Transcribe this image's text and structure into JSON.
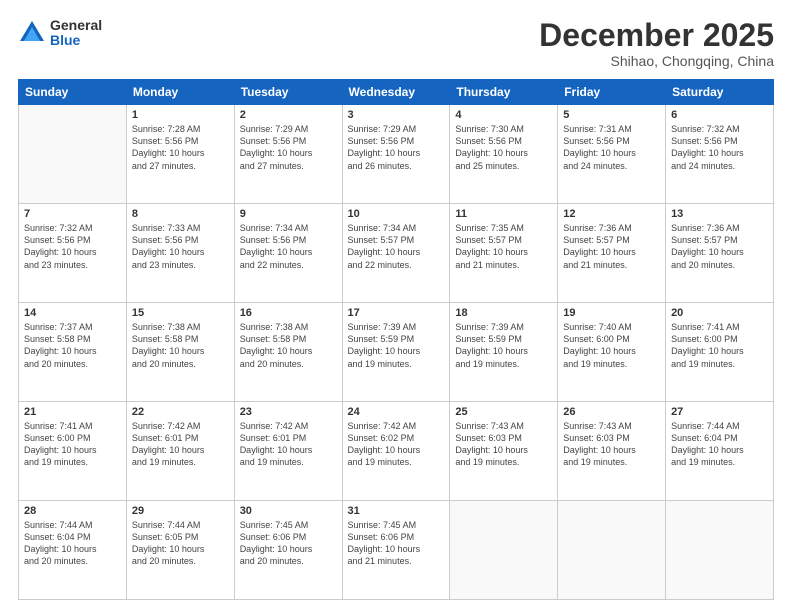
{
  "logo": {
    "general": "General",
    "blue": "Blue"
  },
  "header": {
    "month": "December 2025",
    "location": "Shihao, Chongqing, China"
  },
  "weekdays": [
    "Sunday",
    "Monday",
    "Tuesday",
    "Wednesday",
    "Thursday",
    "Friday",
    "Saturday"
  ],
  "weeks": [
    [
      {
        "day": "",
        "info": ""
      },
      {
        "day": "1",
        "info": "Sunrise: 7:28 AM\nSunset: 5:56 PM\nDaylight: 10 hours\nand 27 minutes."
      },
      {
        "day": "2",
        "info": "Sunrise: 7:29 AM\nSunset: 5:56 PM\nDaylight: 10 hours\nand 27 minutes."
      },
      {
        "day": "3",
        "info": "Sunrise: 7:29 AM\nSunset: 5:56 PM\nDaylight: 10 hours\nand 26 minutes."
      },
      {
        "day": "4",
        "info": "Sunrise: 7:30 AM\nSunset: 5:56 PM\nDaylight: 10 hours\nand 25 minutes."
      },
      {
        "day": "5",
        "info": "Sunrise: 7:31 AM\nSunset: 5:56 PM\nDaylight: 10 hours\nand 24 minutes."
      },
      {
        "day": "6",
        "info": "Sunrise: 7:32 AM\nSunset: 5:56 PM\nDaylight: 10 hours\nand 24 minutes."
      }
    ],
    [
      {
        "day": "7",
        "info": "Sunrise: 7:32 AM\nSunset: 5:56 PM\nDaylight: 10 hours\nand 23 minutes."
      },
      {
        "day": "8",
        "info": "Sunrise: 7:33 AM\nSunset: 5:56 PM\nDaylight: 10 hours\nand 23 minutes."
      },
      {
        "day": "9",
        "info": "Sunrise: 7:34 AM\nSunset: 5:56 PM\nDaylight: 10 hours\nand 22 minutes."
      },
      {
        "day": "10",
        "info": "Sunrise: 7:34 AM\nSunset: 5:57 PM\nDaylight: 10 hours\nand 22 minutes."
      },
      {
        "day": "11",
        "info": "Sunrise: 7:35 AM\nSunset: 5:57 PM\nDaylight: 10 hours\nand 21 minutes."
      },
      {
        "day": "12",
        "info": "Sunrise: 7:36 AM\nSunset: 5:57 PM\nDaylight: 10 hours\nand 21 minutes."
      },
      {
        "day": "13",
        "info": "Sunrise: 7:36 AM\nSunset: 5:57 PM\nDaylight: 10 hours\nand 20 minutes."
      }
    ],
    [
      {
        "day": "14",
        "info": "Sunrise: 7:37 AM\nSunset: 5:58 PM\nDaylight: 10 hours\nand 20 minutes."
      },
      {
        "day": "15",
        "info": "Sunrise: 7:38 AM\nSunset: 5:58 PM\nDaylight: 10 hours\nand 20 minutes."
      },
      {
        "day": "16",
        "info": "Sunrise: 7:38 AM\nSunset: 5:58 PM\nDaylight: 10 hours\nand 20 minutes."
      },
      {
        "day": "17",
        "info": "Sunrise: 7:39 AM\nSunset: 5:59 PM\nDaylight: 10 hours\nand 19 minutes."
      },
      {
        "day": "18",
        "info": "Sunrise: 7:39 AM\nSunset: 5:59 PM\nDaylight: 10 hours\nand 19 minutes."
      },
      {
        "day": "19",
        "info": "Sunrise: 7:40 AM\nSunset: 6:00 PM\nDaylight: 10 hours\nand 19 minutes."
      },
      {
        "day": "20",
        "info": "Sunrise: 7:41 AM\nSunset: 6:00 PM\nDaylight: 10 hours\nand 19 minutes."
      }
    ],
    [
      {
        "day": "21",
        "info": "Sunrise: 7:41 AM\nSunset: 6:00 PM\nDaylight: 10 hours\nand 19 minutes."
      },
      {
        "day": "22",
        "info": "Sunrise: 7:42 AM\nSunset: 6:01 PM\nDaylight: 10 hours\nand 19 minutes."
      },
      {
        "day": "23",
        "info": "Sunrise: 7:42 AM\nSunset: 6:01 PM\nDaylight: 10 hours\nand 19 minutes."
      },
      {
        "day": "24",
        "info": "Sunrise: 7:42 AM\nSunset: 6:02 PM\nDaylight: 10 hours\nand 19 minutes."
      },
      {
        "day": "25",
        "info": "Sunrise: 7:43 AM\nSunset: 6:03 PM\nDaylight: 10 hours\nand 19 minutes."
      },
      {
        "day": "26",
        "info": "Sunrise: 7:43 AM\nSunset: 6:03 PM\nDaylight: 10 hours\nand 19 minutes."
      },
      {
        "day": "27",
        "info": "Sunrise: 7:44 AM\nSunset: 6:04 PM\nDaylight: 10 hours\nand 19 minutes."
      }
    ],
    [
      {
        "day": "28",
        "info": "Sunrise: 7:44 AM\nSunset: 6:04 PM\nDaylight: 10 hours\nand 20 minutes."
      },
      {
        "day": "29",
        "info": "Sunrise: 7:44 AM\nSunset: 6:05 PM\nDaylight: 10 hours\nand 20 minutes."
      },
      {
        "day": "30",
        "info": "Sunrise: 7:45 AM\nSunset: 6:06 PM\nDaylight: 10 hours\nand 20 minutes."
      },
      {
        "day": "31",
        "info": "Sunrise: 7:45 AM\nSunset: 6:06 PM\nDaylight: 10 hours\nand 21 minutes."
      },
      {
        "day": "",
        "info": ""
      },
      {
        "day": "",
        "info": ""
      },
      {
        "day": "",
        "info": ""
      }
    ]
  ]
}
